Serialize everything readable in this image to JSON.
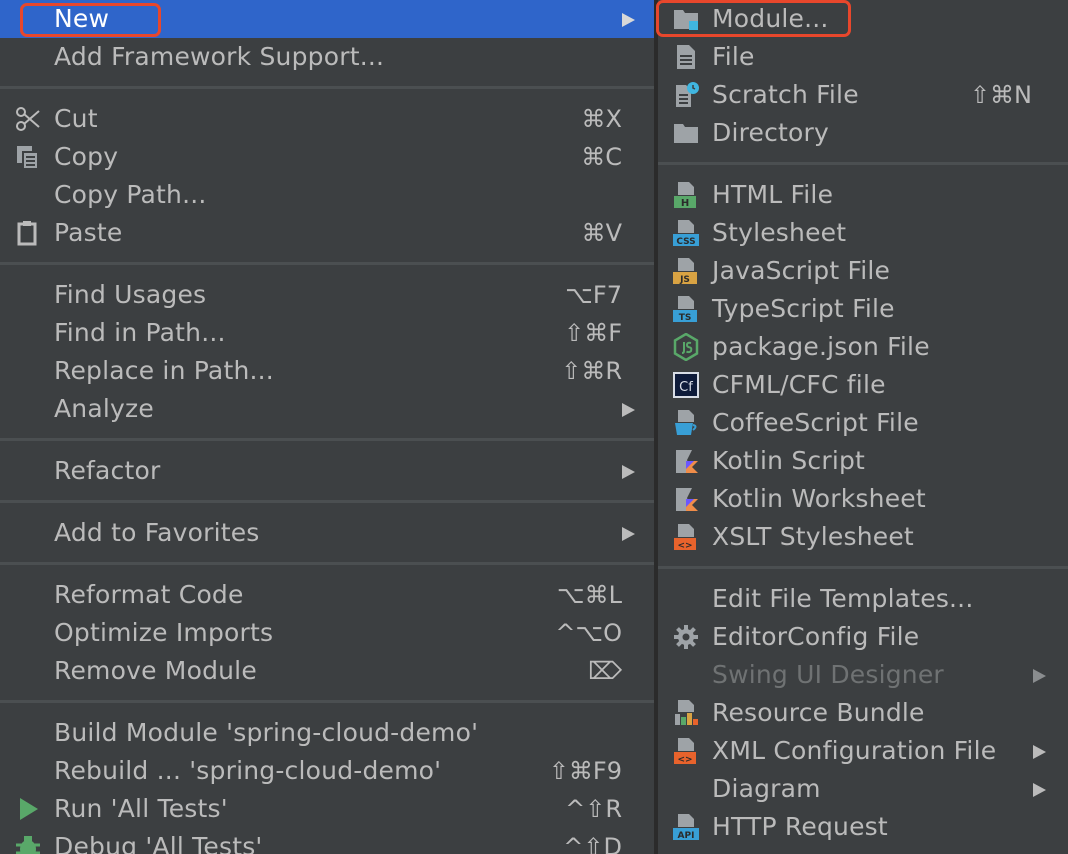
{
  "left_menu": {
    "items": [
      {
        "label": "New",
        "shortcut": ""
      },
      {
        "label": "Add Framework Support...",
        "shortcut": ""
      },
      {
        "label": "Cut",
        "shortcut": "⌘X"
      },
      {
        "label": "Copy",
        "shortcut": "⌘C"
      },
      {
        "label": "Copy Path...",
        "shortcut": ""
      },
      {
        "label": "Paste",
        "shortcut": "⌘V"
      },
      {
        "label": "Find Usages",
        "shortcut": "⌥F7"
      },
      {
        "label": "Find in Path...",
        "shortcut": "⇧⌘F"
      },
      {
        "label": "Replace in Path...",
        "shortcut": "⇧⌘R"
      },
      {
        "label": "Analyze",
        "shortcut": ""
      },
      {
        "label": "Refactor",
        "shortcut": ""
      },
      {
        "label": "Add to Favorites",
        "shortcut": ""
      },
      {
        "label": "Reformat Code",
        "shortcut": "⌥⌘L"
      },
      {
        "label": "Optimize Imports",
        "shortcut": "^⌥O"
      },
      {
        "label": "Remove Module",
        "shortcut": "⌦"
      },
      {
        "label": "Build Module 'spring-cloud-demo'",
        "shortcut": ""
      },
      {
        "label": "Rebuild ... 'spring-cloud-demo'",
        "shortcut": "⇧⌘F9"
      },
      {
        "label": "Run 'All Tests'",
        "shortcut": "^⇧R"
      },
      {
        "label": "Debug 'All Tests'",
        "shortcut": "^⇧D"
      }
    ]
  },
  "right_menu": {
    "items": [
      {
        "label": "Module...",
        "shortcut": ""
      },
      {
        "label": "File",
        "shortcut": ""
      },
      {
        "label": "Scratch File",
        "shortcut": "⇧⌘N"
      },
      {
        "label": "Directory",
        "shortcut": ""
      },
      {
        "label": "HTML File",
        "shortcut": ""
      },
      {
        "label": "Stylesheet",
        "shortcut": ""
      },
      {
        "label": "JavaScript File",
        "shortcut": ""
      },
      {
        "label": "TypeScript File",
        "shortcut": ""
      },
      {
        "label": "package.json File",
        "shortcut": ""
      },
      {
        "label": "CFML/CFC file",
        "shortcut": ""
      },
      {
        "label": "CoffeeScript File",
        "shortcut": ""
      },
      {
        "label": "Kotlin Script",
        "shortcut": ""
      },
      {
        "label": "Kotlin Worksheet",
        "shortcut": ""
      },
      {
        "label": "XSLT Stylesheet",
        "shortcut": ""
      },
      {
        "label": "Edit File Templates...",
        "shortcut": ""
      },
      {
        "label": "EditorConfig File",
        "shortcut": ""
      },
      {
        "label": "Swing UI Designer",
        "shortcut": ""
      },
      {
        "label": "Resource Bundle",
        "shortcut": ""
      },
      {
        "label": "XML Configuration File",
        "shortcut": ""
      },
      {
        "label": "Diagram",
        "shortcut": ""
      },
      {
        "label": "HTTP Request",
        "shortcut": ""
      }
    ],
    "icon_badges": {
      "html": "H",
      "css": "CSS",
      "js": "JS",
      "ts": "TS",
      "cf": "Cf",
      "xslt": "<>",
      "xml": "<>",
      "api": "API"
    }
  },
  "colors": {
    "menu_background": "#3c3f41",
    "selection": "#2f65ca",
    "highlight_outline": "#e8472c",
    "text": "#bbbbbb",
    "disabled_text": "#6f7273"
  }
}
